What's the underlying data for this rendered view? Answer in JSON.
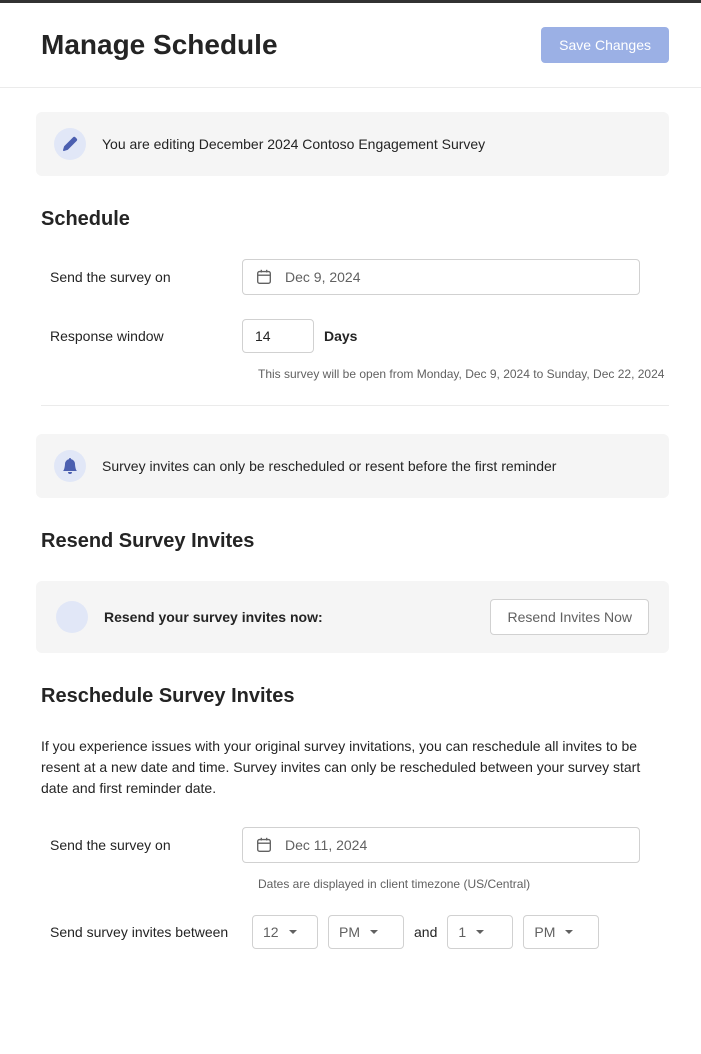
{
  "header": {
    "title": "Manage Schedule",
    "save_button": "Save Changes"
  },
  "editing_banner": {
    "text": "You are editing December 2024 Contoso Engagement Survey"
  },
  "schedule": {
    "title": "Schedule",
    "send_label": "Send the survey on",
    "send_date": "Dec 9, 2024",
    "response_label": "Response window",
    "response_days": "14",
    "days_label": "Days",
    "window_text": "This survey will be open from Monday, Dec 9, 2024 to Sunday, Dec 22, 2024"
  },
  "reminder_banner": {
    "text": "Survey invites can only be rescheduled or resent before the first reminder"
  },
  "resend": {
    "title": "Resend Survey Invites",
    "box_label": "Resend your survey invites now:",
    "button": "Resend Invites Now"
  },
  "reschedule": {
    "title": "Reschedule Survey Invites",
    "description": "If you experience issues with your original survey invitations, you can reschedule all invites to be resent at a new date and time. Survey invites can only be rescheduled between your survey start date and first reminder date.",
    "send_label": "Send the survey on",
    "send_date": "Dec 11, 2024",
    "timezone_text": "Dates are displayed in client timezone (US/Central)",
    "between_label": "Send survey invites between",
    "from_hour": "12",
    "from_ampm": "PM",
    "and_text": "and",
    "to_hour": "1",
    "to_ampm": "PM"
  }
}
